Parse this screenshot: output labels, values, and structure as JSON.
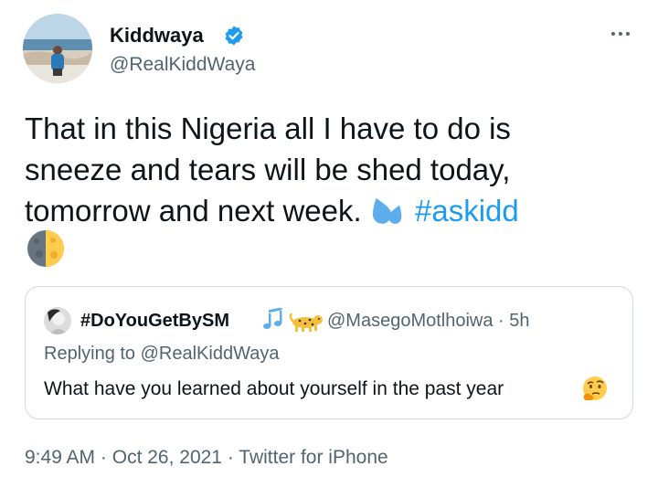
{
  "author": {
    "display_name": "Kiddwaya",
    "handle": "@RealKiddWaya",
    "verified_icon": "verified-badge-icon",
    "avatar_icon": "profile-photo"
  },
  "tweet": {
    "text_main": "That in this Nigeria all I have to do is\nsneeze and tears will be shed today,\ntomorrow and next week. ",
    "emoji_1": "sweat-droplets-emoji",
    "hashtag": "#askidd",
    "emoji_2": "last-quarter-moon-emoji"
  },
  "quoted_tweet": {
    "display_name": "#DoYouGetBySM",
    "name_emojis": [
      "musical-notes-emoji",
      "leopard-emoji"
    ],
    "handle_time": "@MasegoMotlhoiwa · 5h",
    "replying_prefix": "Replying to ",
    "replying_to": "@RealKiddWaya",
    "text": "What have you learned about yourself in the past year",
    "text_emoji": "thinking-face-emoji"
  },
  "meta": {
    "time": "9:49 AM",
    "sep1": " · ",
    "date": "Oct 26, 2021",
    "sep2": " · ",
    "source": "Twitter for iPhone"
  },
  "colors": {
    "link": "#1d9bf0",
    "secondary": "#536471",
    "text": "#0f1419",
    "border": "#cfd9de"
  }
}
